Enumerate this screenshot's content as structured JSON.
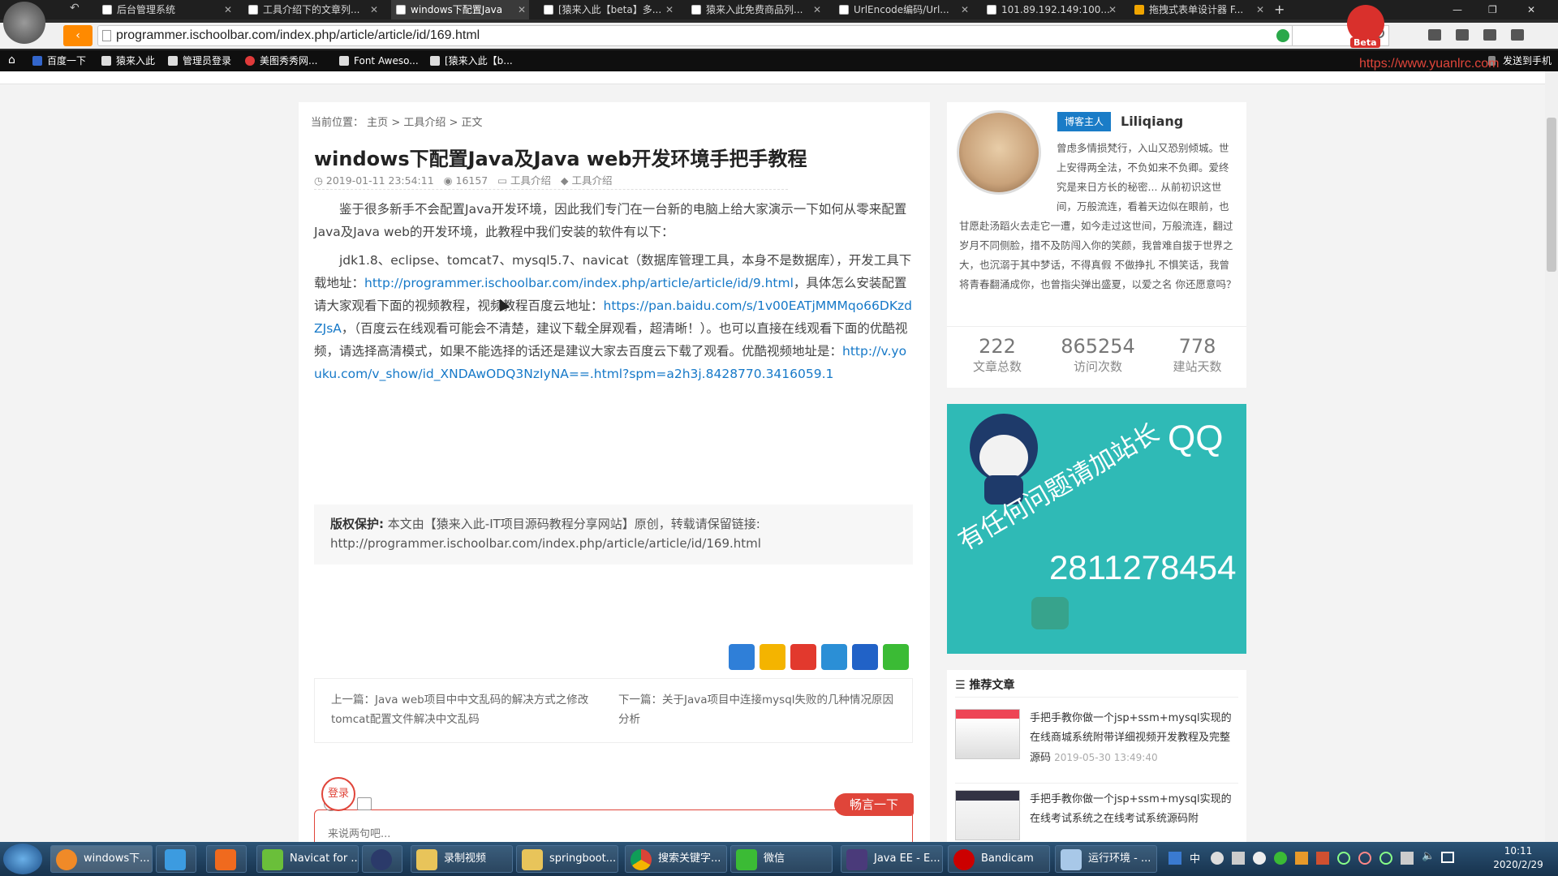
{
  "tabs": [
    {
      "label": "后台管理系统"
    },
    {
      "label": "工具介绍下的文章列..."
    },
    {
      "label": "windows下配置Java"
    },
    {
      "label": "[猿来入此【beta】多..."
    },
    {
      "label": "猿来入此免费商品列..."
    },
    {
      "label": "UrlEncode编码/Url..."
    },
    {
      "label": "101.89.192.149:100..."
    },
    {
      "label": "拖拽式表单设计器 F..."
    }
  ],
  "url": "programmer.ischoolbar.com/index.php/article/article/id/169.html",
  "bookmarks": [
    "百度一下",
    "猿来入此",
    "管理员登录",
    "美图秀秀网...",
    "Font Aweso...",
    "[猿来入此【b..."
  ],
  "watermark": {
    "url": "https://www.yuanlrc.com",
    "badge": "Beta"
  },
  "send_to_phone": "发送到手机",
  "breadcrumb": {
    "prefix": "当前位置：",
    "home": "主页",
    "sep1": " > ",
    "cat": "工具介绍",
    "sep2": " > ",
    "current": "正文"
  },
  "article": {
    "title": "windows下配置Java及Java web开发环境手把手教程",
    "date": "2019-01-11 23:54:11",
    "views": "16157",
    "category": "工具介绍",
    "tag": "工具介绍",
    "p1": "鉴于很多新手不会配置Java开发环境，因此我们专门在一台新的电脑上给大家演示一下如何从零来配置Java及Java web的开发环境，此教程中我们安装的软件有以下：",
    "p2_a": "jdk1.8、eclipse、tomcat7、mysql5.7、navicat（数据库管理工具，本身不是数据库），开发工具下载地址：",
    "p2_link1": "http://programmer.ischoolbar.com/index.php/article/article/id/9.html",
    "p2_b": "，具体怎么安装配置请大家观看下面的视频教程，视频教程百度云地址：",
    "p2_link2": "https://pan.baidu.com/s/1v00EATjMMMqo66DKzdZJsA",
    "p2_c": "，（百度云在线观看可能会不清楚，建议下载全屏观看，超清晰！）。也可以直接在线观看下面的优酷视频，请选择高清模式，如果不能选择的话还是建议大家去百度云下载了观看。优酷视频地址是：",
    "p2_link3": "http://v.youku.com/v_show/id_XNDAwODQ3NzIyNA==.html?spm=a2h3j.8428770.3416059.1"
  },
  "copyright": {
    "label": "版权保护:",
    "text": "本文由【猿来入此-IT项目源码教程分享网站】原创，转载请保留链接:",
    "url": "http://programmer.ischoolbar.com/index.php/article/article/id/169.html"
  },
  "prev": {
    "label": "上一篇：",
    "title": "Java web项目中中文乱码的解决方式之修改tomcat配置文件解决中文乱码"
  },
  "next": {
    "label": "下一篇：",
    "title": "关于Java项目中连接mysql失败的几种情况原因分析"
  },
  "comment": {
    "login": "登录",
    "placeholder": "来说两句吧...",
    "submit": "畅言一下"
  },
  "profile": {
    "badge": "博客主人",
    "name": "Liliqiang",
    "bio": "曾虑多情损梵行，入山又恐别倾城。世上安得两全法，不负如来不负卿。爱终究是来日方长的秘密... 从前初识这世间，万般流连，看着天边似在眼前，也甘愿赴汤蹈火去走它一遭，如今走过这世间，万般流连，翻过岁月不同侧脸，措不及防闯入你的笑颜，我曾难自拔于世界之大，也沉溺于其中梦话，不得真假 不做挣扎 不惧笑话，我曾将青春翻涌成你，也曾指尖弹出盛夏，以爱之名 你还愿意吗？",
    "stats": [
      {
        "value": "222",
        "label": "文章总数"
      },
      {
        "value": "865254",
        "label": "访问次数"
      },
      {
        "value": "778",
        "label": "建站天数"
      }
    ]
  },
  "ad": {
    "qq_label": "QQ",
    "slogan": "有任何问题请加站长",
    "number": "2811278454"
  },
  "recommend": {
    "title": "推荐文章",
    "items": [
      {
        "title": "手把手教你做一个jsp+ssm+mysql实现的在线商城系统附带详细视频开发教程及完整源码",
        "date": "2019-05-30 13:49:40"
      },
      {
        "title": "手把手教你做一个jsp+ssm+mysql实现的在线考试系统之在线考试系统源码附",
        "date": ""
      }
    ]
  },
  "taskbar": {
    "items": [
      "windows下...",
      "",
      "",
      "Navicat for ...",
      "",
      "录制视频",
      "springboot...",
      "搜索关键字...",
      "微信",
      "Java EE - E...",
      "Bandicam",
      "运行环境 - ..."
    ],
    "time": "10:11",
    "date": "2020/2/29"
  },
  "colors": {
    "link": "#1679c8",
    "badge": "#1a7cc7",
    "ad_bg": "#2fbab6",
    "accent_red": "#e0453a"
  }
}
